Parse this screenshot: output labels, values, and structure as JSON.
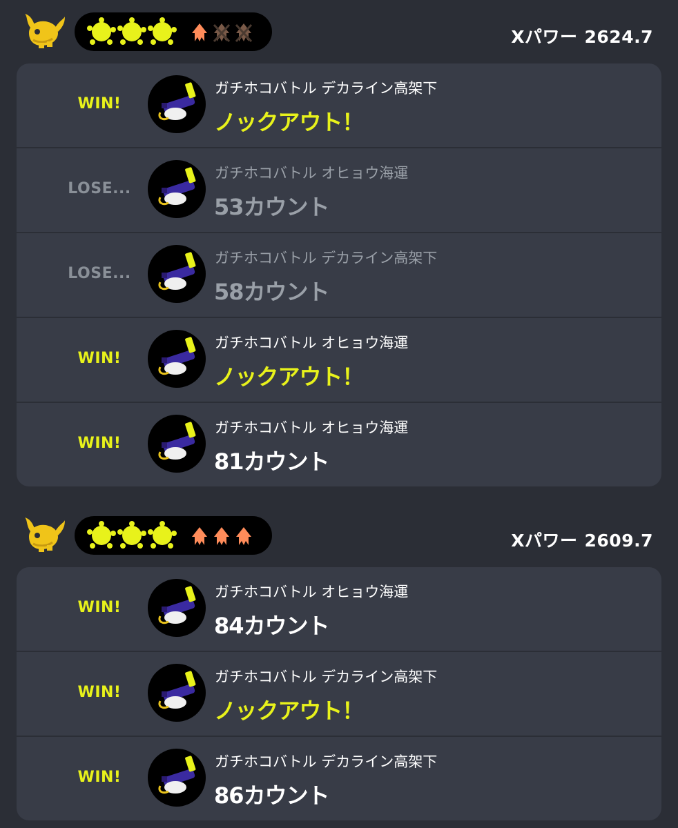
{
  "colors": {
    "background": "#2b2e36",
    "card": "#383c47",
    "win": "#e8f21b",
    "lose": "#8a9098",
    "squid_orange": "#ff8c5a",
    "squid_crossed": "#7a5a48",
    "splat_yellow": "#e8f21b"
  },
  "sets": [
    {
      "xpower_label": "Xパワー",
      "xpower_value": "2624.7",
      "badge": {
        "icon": "whale-icon",
        "splats": 3,
        "squids": [
          {
            "state": "active"
          },
          {
            "state": "crossed"
          },
          {
            "state": "crossed"
          }
        ]
      },
      "battles": [
        {
          "result": "WIN!",
          "outcome": "win",
          "stage": "ガチホコバトル デカライン高架下",
          "score": "ノックアウト！",
          "score_kind": "ko"
        },
        {
          "result": "LOSE...",
          "outcome": "lose",
          "stage": "ガチホコバトル オヒョウ海運",
          "score": "53カウント",
          "score_kind": "dim"
        },
        {
          "result": "LOSE...",
          "outcome": "lose",
          "stage": "ガチホコバトル デカライン高架下",
          "score": "58カウント",
          "score_kind": "dim"
        },
        {
          "result": "WIN!",
          "outcome": "win",
          "stage": "ガチホコバトル オヒョウ海運",
          "score": "ノックアウト！",
          "score_kind": "ko"
        },
        {
          "result": "WIN!",
          "outcome": "win",
          "stage": "ガチホコバトル オヒョウ海運",
          "score": "81カウント",
          "score_kind": "count"
        }
      ]
    },
    {
      "xpower_label": "Xパワー",
      "xpower_value": "2609.7",
      "badge": {
        "icon": "whale-icon",
        "splats": 3,
        "squids": [
          {
            "state": "active"
          },
          {
            "state": "active"
          },
          {
            "state": "active"
          }
        ]
      },
      "battles": [
        {
          "result": "WIN!",
          "outcome": "win",
          "stage": "ガチホコバトル オヒョウ海運",
          "score": "84カウント",
          "score_kind": "count"
        },
        {
          "result": "WIN!",
          "outcome": "win",
          "stage": "ガチホコバトル デカライン高架下",
          "score": "ノックアウト！",
          "score_kind": "ko"
        },
        {
          "result": "WIN!",
          "outcome": "win",
          "stage": "ガチホコバトル デカライン高架下",
          "score": "86カウント",
          "score_kind": "count"
        }
      ]
    }
  ]
}
